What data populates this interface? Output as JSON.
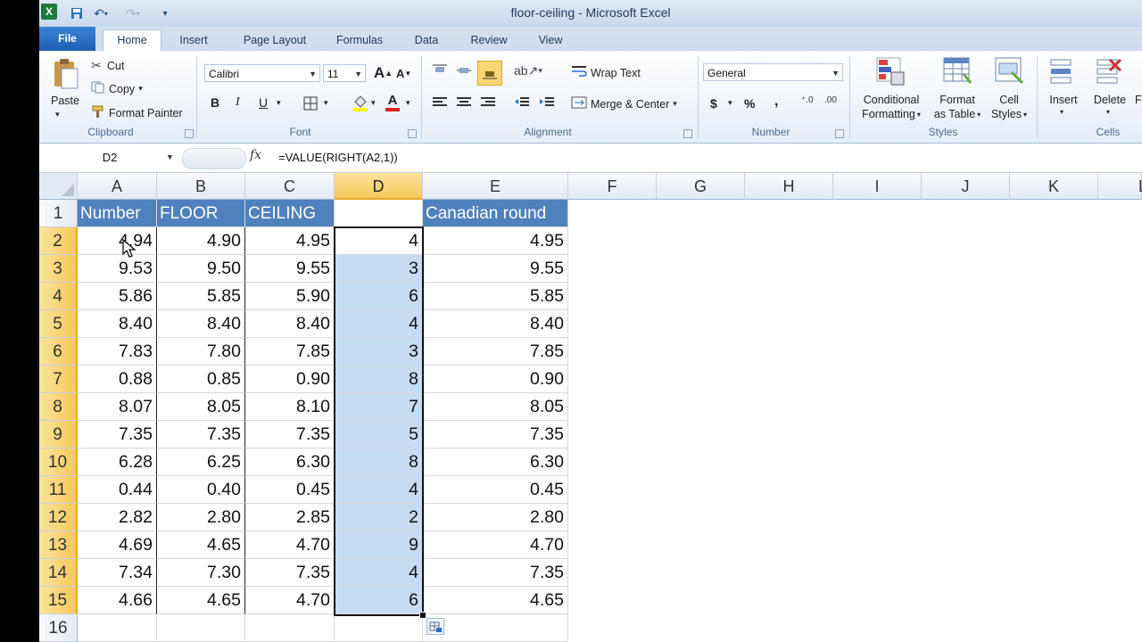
{
  "window": {
    "title": "floor-ceiling - Microsoft Excel",
    "app_logo": "X"
  },
  "tabs": [
    "File",
    "Home",
    "Insert",
    "Page Layout",
    "Formulas",
    "Data",
    "Review",
    "View"
  ],
  "ribbon": {
    "clipboard": {
      "paste": "Paste",
      "cut": "Cut",
      "copy": "Copy",
      "format_painter": "Format Painter",
      "label": "Clipboard"
    },
    "font": {
      "name": "Calibri",
      "size": "11",
      "bold": "B",
      "italic": "I",
      "underline": "U",
      "grow": "A",
      "shrink": "A",
      "font_color": "A",
      "label": "Font"
    },
    "alignment": {
      "wrap_text": "Wrap Text",
      "merge_center": "Merge & Center",
      "label": "Alignment"
    },
    "number": {
      "format": "General",
      "currency": "$",
      "percent": "%",
      "comma": ",",
      "label": "Number"
    },
    "styles": {
      "conditional_1": "Conditional",
      "conditional_2": "Formatting",
      "format_table_1": "Format",
      "format_table_2": "as Table",
      "cell_styles_1": "Cell",
      "cell_styles_2": "Styles",
      "label": "Styles"
    },
    "cells": {
      "insert": "Insert",
      "delete": "Delete",
      "format": "F",
      "label": "Cells"
    }
  },
  "formula_bar": {
    "name_box": "D2",
    "fx": "fx",
    "formula": "=VALUE(RIGHT(A2,1))"
  },
  "grid": {
    "columns": [
      "A",
      "B",
      "C",
      "D",
      "E",
      "F",
      "G",
      "H",
      "I",
      "J",
      "K",
      "L"
    ],
    "selected_column": "D",
    "headers": {
      "A": "Number",
      "B": "FLOOR",
      "C": "CEILING",
      "D": "",
      "E": "Canadian round"
    },
    "row_numbers": [
      "1",
      "2",
      "3",
      "4",
      "5",
      "6",
      "7",
      "8",
      "9",
      "10",
      "11",
      "12",
      "13",
      "14",
      "15",
      "16"
    ],
    "rows": [
      [
        "4.94",
        "4.90",
        "4.95",
        "4",
        "4.95"
      ],
      [
        "9.53",
        "9.50",
        "9.55",
        "3",
        "9.55"
      ],
      [
        "5.86",
        "5.85",
        "5.90",
        "6",
        "5.85"
      ],
      [
        "8.40",
        "8.40",
        "8.40",
        "4",
        "8.40"
      ],
      [
        "7.83",
        "7.80",
        "7.85",
        "3",
        "7.85"
      ],
      [
        "0.88",
        "0.85",
        "0.90",
        "8",
        "0.90"
      ],
      [
        "8.07",
        "8.05",
        "8.10",
        "7",
        "8.05"
      ],
      [
        "7.35",
        "7.35",
        "7.35",
        "5",
        "7.35"
      ],
      [
        "6.28",
        "6.25",
        "6.30",
        "8",
        "6.30"
      ],
      [
        "0.44",
        "0.40",
        "0.45",
        "4",
        "0.45"
      ],
      [
        "2.82",
        "2.80",
        "2.85",
        "2",
        "2.80"
      ],
      [
        "4.69",
        "4.65",
        "4.70",
        "9",
        "4.70"
      ],
      [
        "7.34",
        "7.30",
        "7.35",
        "4",
        "7.35"
      ],
      [
        "4.66",
        "4.65",
        "4.70",
        "6",
        "4.65"
      ]
    ]
  },
  "colors": {
    "header_fill": "#4f81bd",
    "selection_fill": "#c5dcf3",
    "active_header": "#f7c95a"
  }
}
